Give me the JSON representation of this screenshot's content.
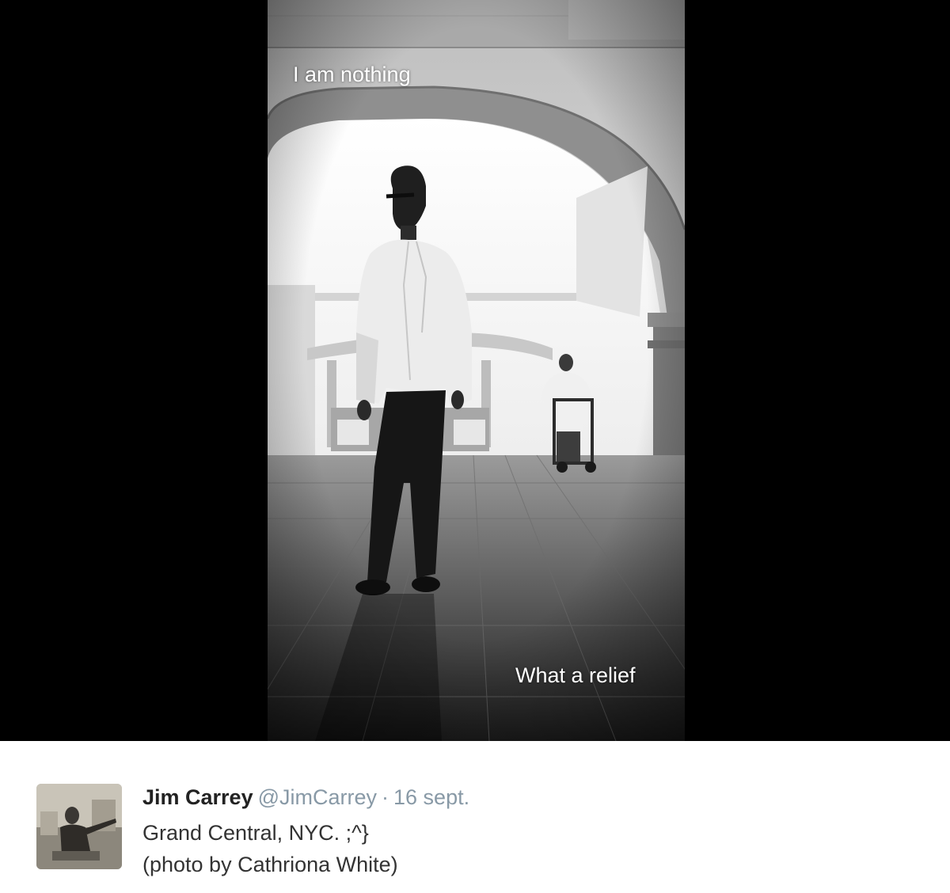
{
  "media": {
    "caption_top": "I am nothing",
    "caption_bottom": "What a relief",
    "background_color": "#000000"
  },
  "tweet": {
    "display_name": "Jim Carrey",
    "handle": "@JimCarrey",
    "separator": "·",
    "timestamp": "16 sept.",
    "text_lines": [
      "Grand Central, NYC. ;^}",
      "(photo by Cathriona White)"
    ],
    "colors": {
      "name": "#222222",
      "meta": "#8899a6",
      "text": "#333333"
    }
  }
}
